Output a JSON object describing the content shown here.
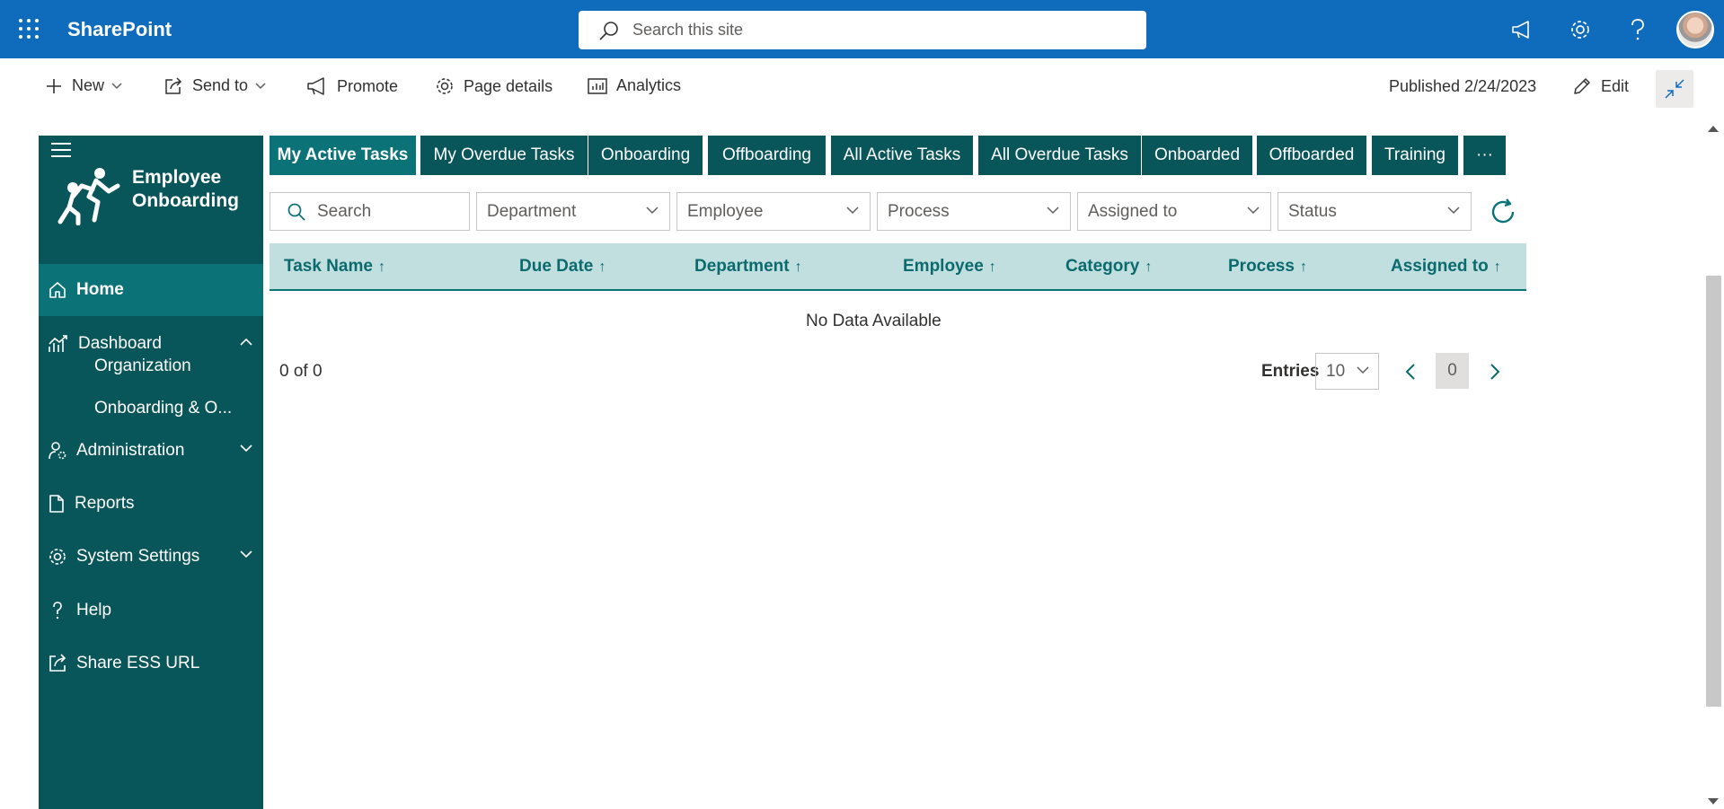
{
  "suite": {
    "app_name": "SharePoint",
    "search_placeholder": "Search this site"
  },
  "commands": {
    "new": "New",
    "send_to": "Send to",
    "promote": "Promote",
    "page_details": "Page details",
    "analytics": "Analytics",
    "published": "Published 2/24/2023",
    "edit": "Edit"
  },
  "nav": {
    "title_line1": "Employee",
    "title_line2": "Onboarding",
    "items": [
      {
        "label": "Home",
        "icon": "home-icon",
        "active": true
      },
      {
        "label": "Dashboard",
        "icon": "chart-icon",
        "expanded": true
      },
      {
        "label": "Organization"
      },
      {
        "label": "Onboarding & O..."
      },
      {
        "label": "Administration",
        "icon": "user-settings-icon"
      },
      {
        "label": "Reports",
        "icon": "document-icon"
      },
      {
        "label": "System Settings",
        "icon": "gear-icon"
      },
      {
        "label": "Help",
        "icon": "question-icon"
      },
      {
        "label": "Share ESS URL",
        "icon": "share-icon"
      }
    ]
  },
  "tabs": [
    "My Active Tasks",
    "My Overdue Tasks",
    "Onboarding",
    "Offboarding",
    "All Active Tasks",
    "All Overdue Tasks",
    "Onboarded",
    "Offboarded",
    "Training",
    "···"
  ],
  "filters": {
    "search_placeholder": "Search",
    "department": "Department",
    "employee": "Employee",
    "process": "Process",
    "assigned_to": "Assigned to",
    "status": "Status"
  },
  "table": {
    "columns": [
      "Task Name",
      "Due Date",
      "Department",
      "Employee",
      "Category",
      "Process",
      "Assigned to"
    ],
    "sort_arrow": "↑",
    "empty_message": "No Data Available",
    "count_text": "0 of 0",
    "entries_label": "Entries",
    "entries_value": "10",
    "current_page": "0"
  },
  "colors": {
    "suite_blue": "#0f6cbd",
    "teal_dark": "#09565a",
    "teal_active": "#0b7378",
    "header_bg": "#c2dfdf"
  }
}
